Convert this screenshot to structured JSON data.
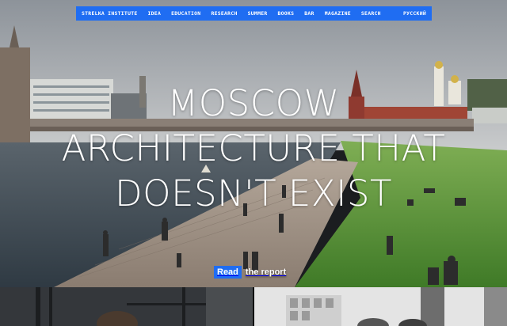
{
  "nav": {
    "items": [
      "STRELKA INSTITUTE",
      "IDEA",
      "EDUCATION",
      "RESEARCH",
      "SUMMER",
      "BOOKS",
      "BAR",
      "MAGAZINE",
      "SEARCH"
    ],
    "lang": "РУССКИЙ"
  },
  "hero": {
    "headline_lines": [
      "MOSCOW",
      "ARCHITECTURE THAT",
      "DOESN'T EXIST"
    ],
    "cta_highlight": "Read",
    "cta_rest": "the report"
  },
  "colors": {
    "accent": "#1f6df2",
    "sky": "#9aa0a6",
    "river": "#3b4650",
    "grass": "#5e9a3d",
    "boardwalk": "#9b8d81"
  }
}
